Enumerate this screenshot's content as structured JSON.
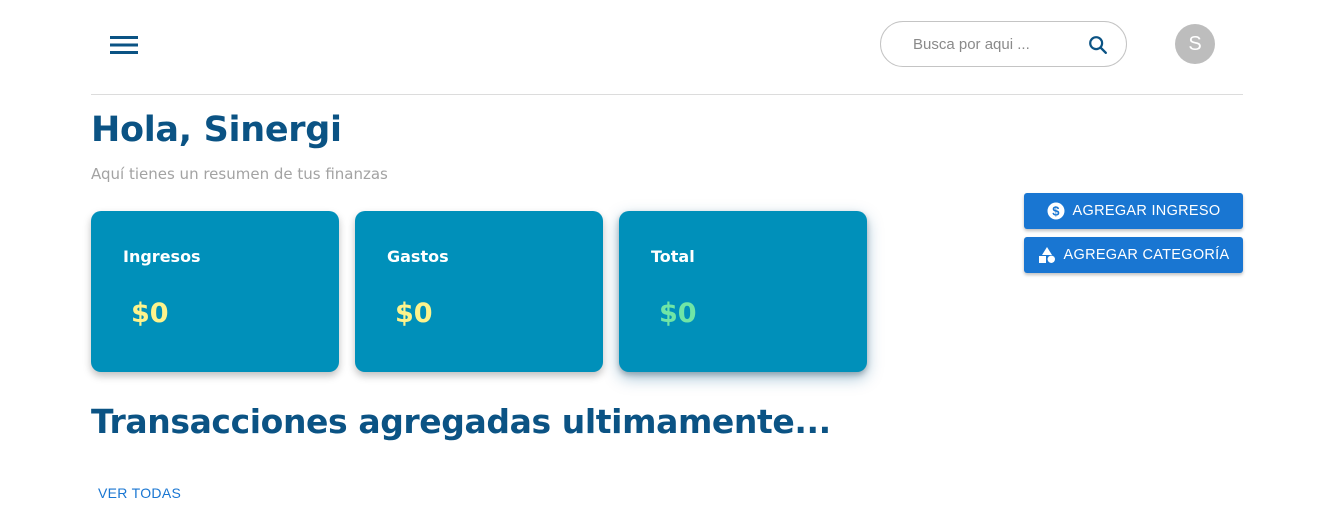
{
  "header": {
    "menu_icon": "hamburger-menu-icon",
    "search": {
      "placeholder": "Busca por aqui ...",
      "value": "",
      "icon": "search-icon"
    },
    "avatar_initial": "S"
  },
  "greeting": {
    "title": "Hola, Sinergi",
    "subtitle": "Aquí tienes un resumen de tus finanzas"
  },
  "summary_cards": [
    {
      "label": "Ingresos",
      "value": "$0",
      "value_color": "#fdf38c"
    },
    {
      "label": "Gastos",
      "value": "$0",
      "value_color": "#fdf38c"
    },
    {
      "label": "Total",
      "value": "$0",
      "value_color": "#6fe5a6"
    }
  ],
  "actions": {
    "add_income": {
      "label": "AGREGAR INGRESO",
      "icon": "dollar-circle-icon"
    },
    "add_category": {
      "label": "AGREGAR CATEGORÍA",
      "icon": "category-shapes-icon"
    }
  },
  "transactions": {
    "title": "Transacciones agregadas ultimamente...",
    "view_all_label": "VER TODAS"
  },
  "colors": {
    "primary_text": "#0b5384",
    "card_bg": "#0090ba",
    "button_bg": "#1976d2"
  }
}
